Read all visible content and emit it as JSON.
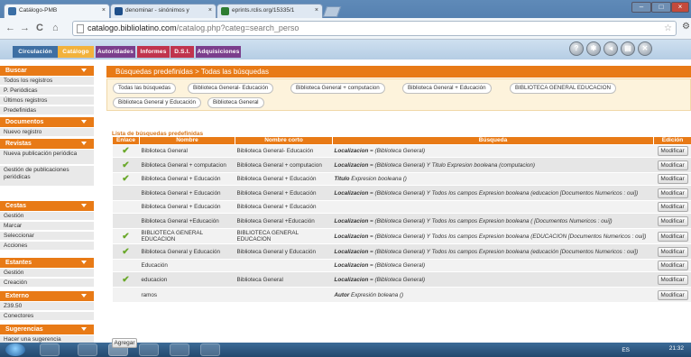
{
  "browser": {
    "tabs": [
      {
        "label": "Catálogo-PMB",
        "active": true
      },
      {
        "label": "denominar - sinónimos y",
        "active": false
      },
      {
        "label": "eprints.rclis.org/15335/1",
        "active": false
      }
    ],
    "url_host": "catalogo.bibliolatino.com",
    "url_path": "/catalog.php?categ=search_perso"
  },
  "main_nav": [
    {
      "label": "Circulación",
      "bg": "#3e6fa3"
    },
    {
      "label": "Catálogo",
      "bg": "#f2b23c"
    },
    {
      "label": "Autoridades",
      "bg": "#7b3e8c"
    },
    {
      "label": "Informes",
      "bg": "#c0344d"
    },
    {
      "label": "D.S.I.",
      "bg": "#c0344d"
    },
    {
      "label": "Adquisiciones",
      "bg": "#7b3e8c"
    }
  ],
  "sidebar": {
    "sections": [
      {
        "title": "Buscar",
        "items": [
          "Todos los registros",
          "P. Periódicas",
          "Últimos registros",
          "Predefinidas"
        ]
      },
      {
        "title": "Documentos",
        "items": [
          "Nuevo registro"
        ]
      },
      {
        "title": "Revistas",
        "items": [
          "Nueva publicación periódica",
          "Gestión de publicaciones periódicas"
        ]
      },
      {
        "title": "Cestas",
        "items": [
          "Gestión",
          "Marcar",
          "Seleccionar",
          "Acciones"
        ]
      },
      {
        "title": "Estantes",
        "items": [
          "Gestión",
          "Creación"
        ]
      },
      {
        "title": "Externo",
        "items": [
          "Z39.50",
          "Conectores"
        ]
      },
      {
        "title": "Sugerencias",
        "items": [
          "Hacer una sugerencia"
        ]
      }
    ]
  },
  "page_title": "Búsquedas predefinidas > Todas las búsquedas",
  "preset_pills": [
    "Todas las búsquedas",
    "Biblioteca General- Educación",
    "Biblioteca General + computacion",
    "Biblioteca General + Educación",
    "BIBLIOTECA GENERAL EDUCACION",
    "Biblioteca General y Educación",
    "Biblioteca General"
  ],
  "list_title": "Lista de búsquedas predefinidas",
  "table": {
    "headers": [
      "Enlace",
      "Nombre",
      "Nombre corto",
      "Búsqueda",
      "Edición"
    ],
    "rows": [
      {
        "link": true,
        "name": "Biblioteca General",
        "short": "Biblioteca General- Educación",
        "search_b": "Localizacion",
        "search": " = (Biblioteca General)"
      },
      {
        "link": true,
        "name": "Biblioteca General + computacion",
        "short": "Biblioteca General + computacion",
        "search_b": "Localizacion",
        "search": " = (Biblioteca General) Y Titulo Expresion booleana (computacion)"
      },
      {
        "link": true,
        "name": "Biblioteca General + Educación",
        "short": "Biblioteca General + Educación",
        "search_b": "Titulo",
        "search": " Expresion booleana ()"
      },
      {
        "link": false,
        "name": "Biblioteca General + Educación",
        "short": "Biblioteca General + Educación",
        "search_b": "Localizacion",
        "search": " = (Biblioteca General) Y Todos los campos Expresion booleana (educacion [Documentos Numericos : oui])"
      },
      {
        "link": false,
        "name": "Biblioteca General + Educación",
        "short": "Biblioteca General + Educación",
        "search_b": "",
        "search": ""
      },
      {
        "link": false,
        "name": "Biblioteca General +Educación",
        "short": "Biblioteca General +Educación",
        "search_b": "Localizacion",
        "search": " = (Biblioteca General) Y Todos los campos Expresion booleana ( [Documentos Numericos : oui])"
      },
      {
        "link": true,
        "name": "BIBLIOTECA GENERAL EDUCACION",
        "short": "BIBLIOTECA GENERAL EDUCACION",
        "search_b": "Localizacion",
        "search": " = (Biblioteca General) Y Todos los campos Expresion booleana (EDUCACION [Documentos Numericos : oui])"
      },
      {
        "link": true,
        "name": "Biblioteca General y Educación",
        "short": "Biblioteca General y Educación",
        "search_b": "Localizacion",
        "search": " = (Biblioteca General) Y Todos los campos Expresion booleana (educación [Documentos Numericos : oui])"
      },
      {
        "link": false,
        "name": "Educación",
        "short": "",
        "search_b": "Localizacion",
        "search": " = (Biblioteca General)"
      },
      {
        "link": true,
        "name": "educacion",
        "short": "Biblioteca General",
        "search_b": "Localizacion",
        "search": " = (Biblioteca General)"
      },
      {
        "link": false,
        "name": "ramos",
        "short": "",
        "search_b": "Autor",
        "search": " Expresión boleana ()"
      }
    ],
    "edit_label": "Modificar"
  },
  "add_label": "Agregar",
  "taskbar": {
    "lang": "ES",
    "time": "21:32"
  }
}
